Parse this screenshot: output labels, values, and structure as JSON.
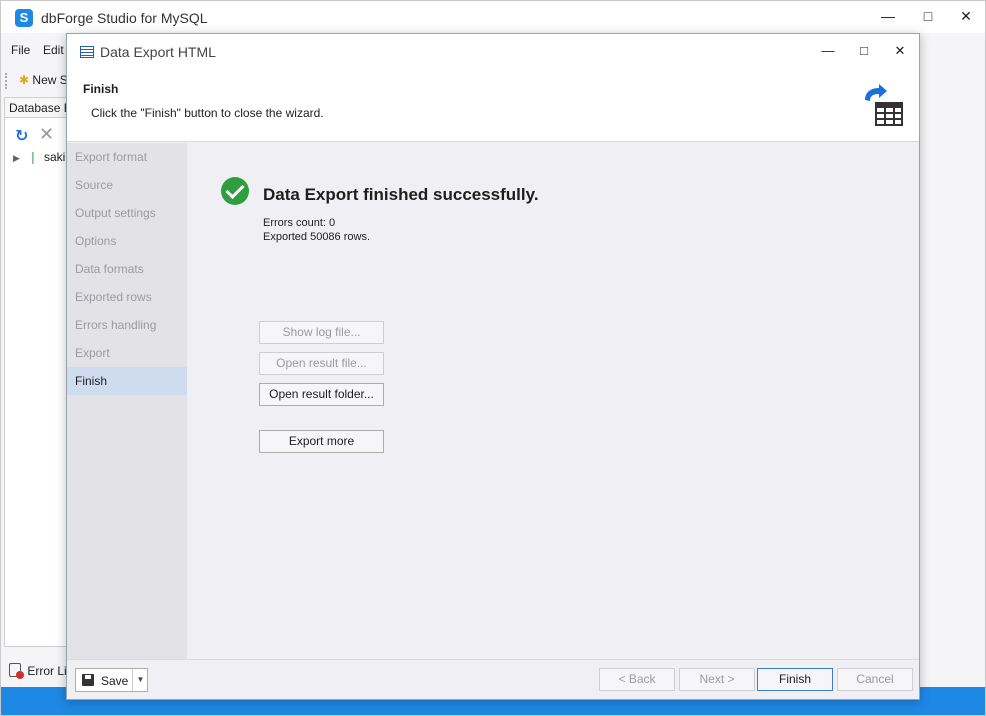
{
  "app": {
    "title": "dbForge Studio for MySQL",
    "logo_letter": "S",
    "menu": [
      "File",
      "Edit"
    ],
    "toolbar_new": "New S",
    "db_explorer_tab": "Database Ex",
    "tree_item": "sakil",
    "error_list": "Error Lis",
    "accent_color": "#1e88e5"
  },
  "dialog": {
    "title": "Data Export HTML",
    "header": {
      "title": "Finish",
      "subtitle": "Click the \"Finish\" button to close the wizard."
    },
    "steps": [
      {
        "label": "Export format",
        "active": false
      },
      {
        "label": "Source",
        "active": false
      },
      {
        "label": "Output settings",
        "active": false
      },
      {
        "label": "Options",
        "active": false
      },
      {
        "label": "Data formats",
        "active": false
      },
      {
        "label": "Exported rows",
        "active": false
      },
      {
        "label": "Errors handling",
        "active": false
      },
      {
        "label": "Export",
        "active": false
      },
      {
        "label": "Finish",
        "active": true
      }
    ],
    "result": {
      "heading": "Data Export finished successfully.",
      "errors_count": "Errors count: 0",
      "exported_rows": "Exported 50086 rows."
    },
    "actions": {
      "show_log": "Show log file...",
      "open_result_file": "Open result file...",
      "open_result_folder": "Open result folder...",
      "export_more": "Export more"
    },
    "footer": {
      "save": "Save",
      "back": "< Back",
      "next": "Next >",
      "finish": "Finish",
      "cancel": "Cancel"
    }
  }
}
